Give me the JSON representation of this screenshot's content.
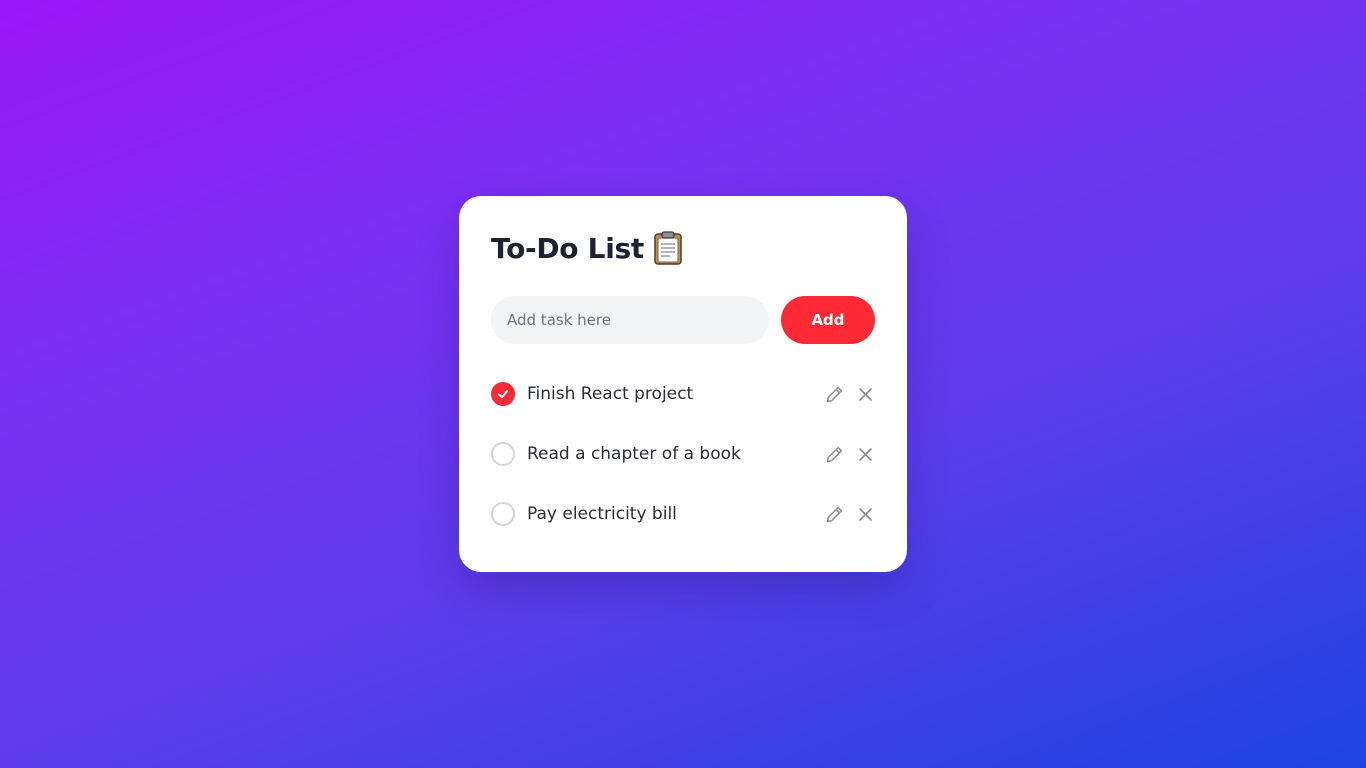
{
  "app": {
    "title": "To-Do List",
    "title_icon": "clipboard-icon"
  },
  "new_task": {
    "value": "",
    "placeholder": "Add task here",
    "add_label": "Add"
  },
  "colors": {
    "accent": "#ff2a36",
    "text": "#1f2330",
    "input_bg": "#f2f3f5",
    "muted_icon": "#8a8d99"
  },
  "tasks": [
    {
      "text": "Finish React project",
      "completed": true,
      "edit_icon": "pencil-icon",
      "delete_icon": "close-icon"
    },
    {
      "text": "Read a chapter of a book",
      "completed": false,
      "edit_icon": "pencil-icon",
      "delete_icon": "close-icon"
    },
    {
      "text": "Pay electricity bill",
      "completed": false,
      "edit_icon": "pencil-icon",
      "delete_icon": "close-icon"
    }
  ]
}
